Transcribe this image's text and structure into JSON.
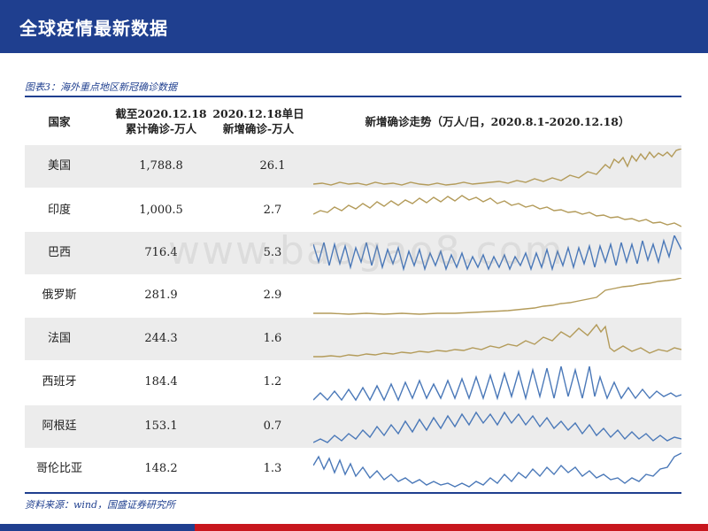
{
  "header": {
    "title": "全球疫情最新数据"
  },
  "figure": {
    "caption": "图表3：海外重点地区新冠确诊数据"
  },
  "table": {
    "headers": {
      "country": "国家",
      "total_line1": "截至2020.12.18",
      "total_line2": "累计确诊-万人",
      "daily_line1": "2020.12.18单日",
      "daily_line2": "新增确诊-万人",
      "trend": "新增确诊走势（万人/日，2020.8.1-2020.12.18）"
    },
    "rows": [
      {
        "country": "美国",
        "total": "1,788.8",
        "daily": "26.1"
      },
      {
        "country": "印度",
        "total": "1,000.5",
        "daily": "2.7"
      },
      {
        "country": "巴西",
        "total": "716.4",
        "daily": "5.3"
      },
      {
        "country": "俄罗斯",
        "total": "281.9",
        "daily": "2.9"
      },
      {
        "country": "法国",
        "total": "244.3",
        "daily": "1.6"
      },
      {
        "country": "西班牙",
        "total": "184.4",
        "daily": "1.2"
      },
      {
        "country": "阿根廷",
        "total": "153.1",
        "daily": "0.7"
      },
      {
        "country": "哥伦比亚",
        "total": "148.2",
        "daily": "1.3"
      }
    ]
  },
  "source": "资料来源：wind，国盛证券研究所",
  "watermark": "www.baogao8.com",
  "colors": {
    "brand_blue": "#1f3f8f",
    "accent_red": "#c8161d",
    "line_tan": "#b39b5a",
    "line_blue": "#4a78b8"
  }
}
